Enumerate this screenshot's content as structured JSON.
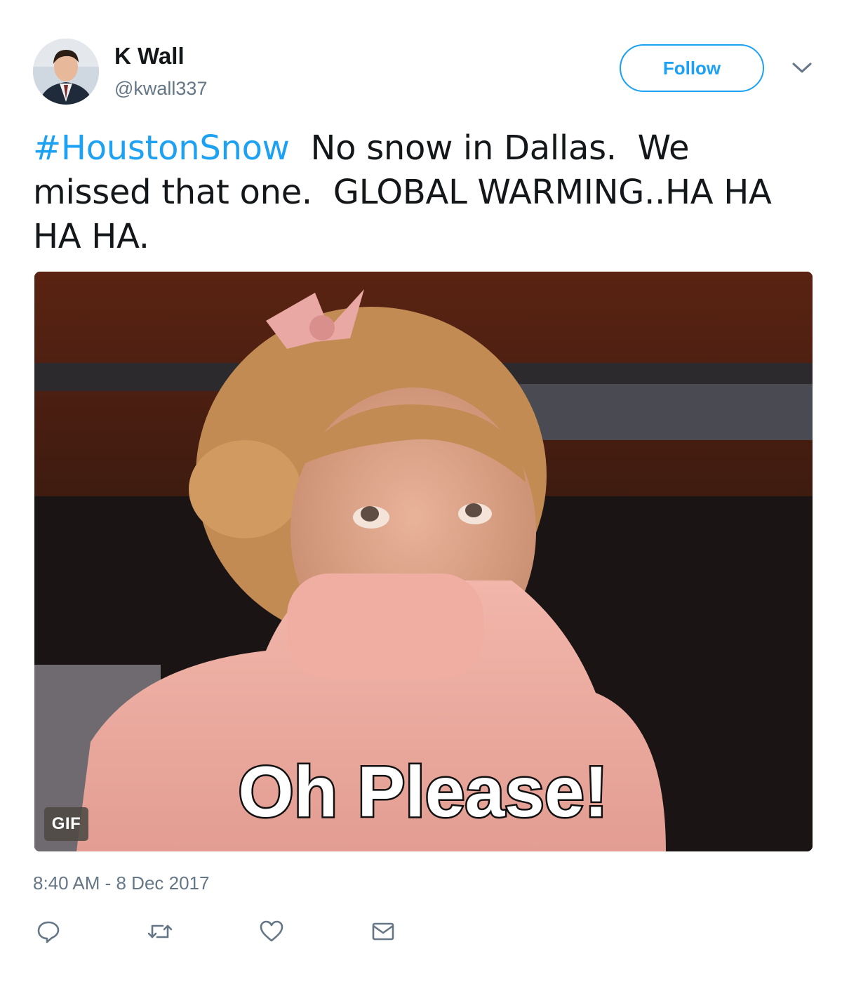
{
  "user": {
    "display_name": "K Wall",
    "handle": "@kwall337"
  },
  "follow_button": {
    "label": "Follow"
  },
  "tweet": {
    "hashtag": "#HoustonSnow",
    "text_line1": "  No snow in Dallas.  We",
    "text_line2": "missed that one.  GLOBAL WARMING..HA HA",
    "text_line3": "HA HA."
  },
  "media": {
    "caption": "Oh Please!",
    "badge": "GIF"
  },
  "timestamp": "8:40 AM - 8 Dec 2017",
  "actions": {
    "reply_icon": "reply-icon",
    "retweet_icon": "retweet-icon",
    "like_icon": "heart-icon",
    "dm_icon": "envelope-icon"
  },
  "colors": {
    "accent": "#1da1f2",
    "secondary_text": "#657786",
    "primary_text": "#14171a"
  }
}
